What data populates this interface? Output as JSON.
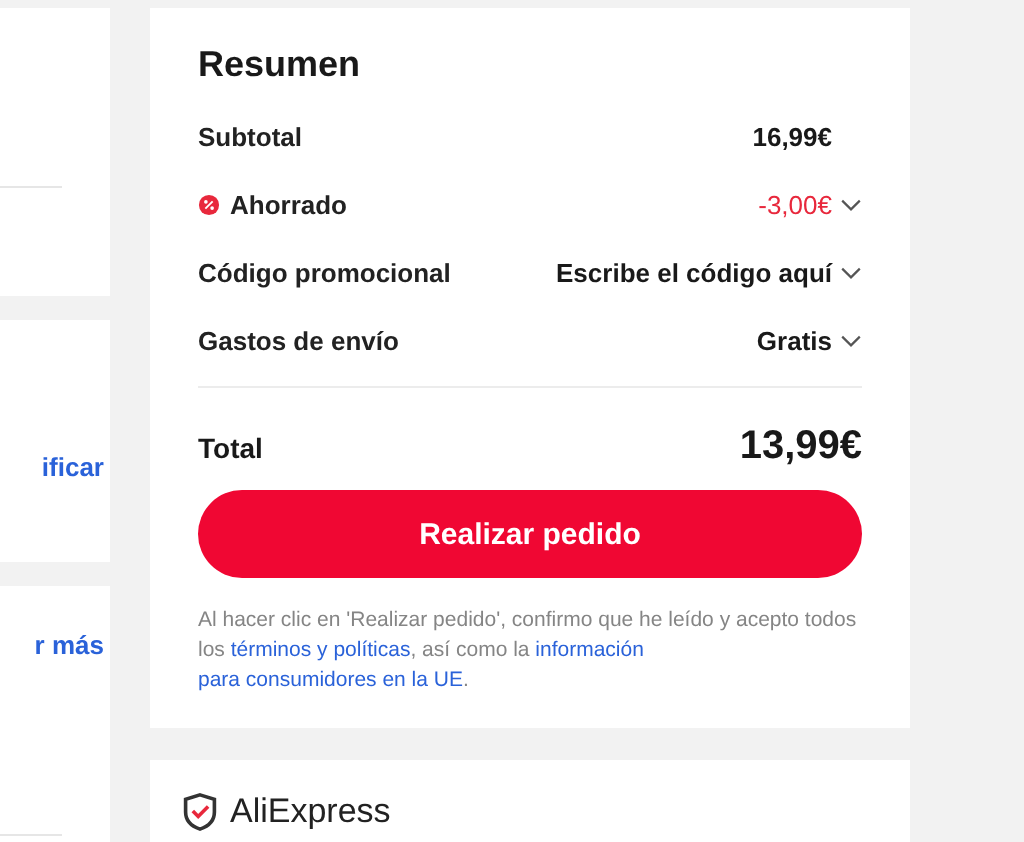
{
  "left_cards": [
    {
      "divider": true
    },
    {
      "link": "ificar",
      "divider": false
    },
    {
      "link": "r más",
      "divider": true
    }
  ],
  "summary": {
    "title": "Resumen",
    "rows": [
      {
        "kind": "plain",
        "label": "Subtotal",
        "value": "16,99€",
        "chevron": false
      },
      {
        "kind": "discount",
        "label": "Ahorrado",
        "value": "-3,00€",
        "chevron": true
      },
      {
        "kind": "plain",
        "label": "Código promocional",
        "value": "Escribe el código aquí",
        "chevron": true
      },
      {
        "kind": "plain",
        "label": "Gastos de envío",
        "value": "Gratis",
        "chevron": true
      }
    ],
    "total_label": "Total",
    "total_value": "13,99€",
    "button": "Realizar pedido",
    "disclaimer": [
      {
        "kind": "text",
        "text": "Al hacer clic en 'Realizar pedido', confirmo que he leído y acepto todos los "
      },
      {
        "kind": "link",
        "text": "términos y políticas"
      },
      {
        "kind": "text",
        "text": ", así como la "
      },
      {
        "kind": "link",
        "text": "información"
      },
      {
        "kind": "link",
        "text": "para consumidores en la UE"
      },
      {
        "kind": "text",
        "text": "."
      }
    ]
  },
  "brand": {
    "name": "AliExpress"
  }
}
